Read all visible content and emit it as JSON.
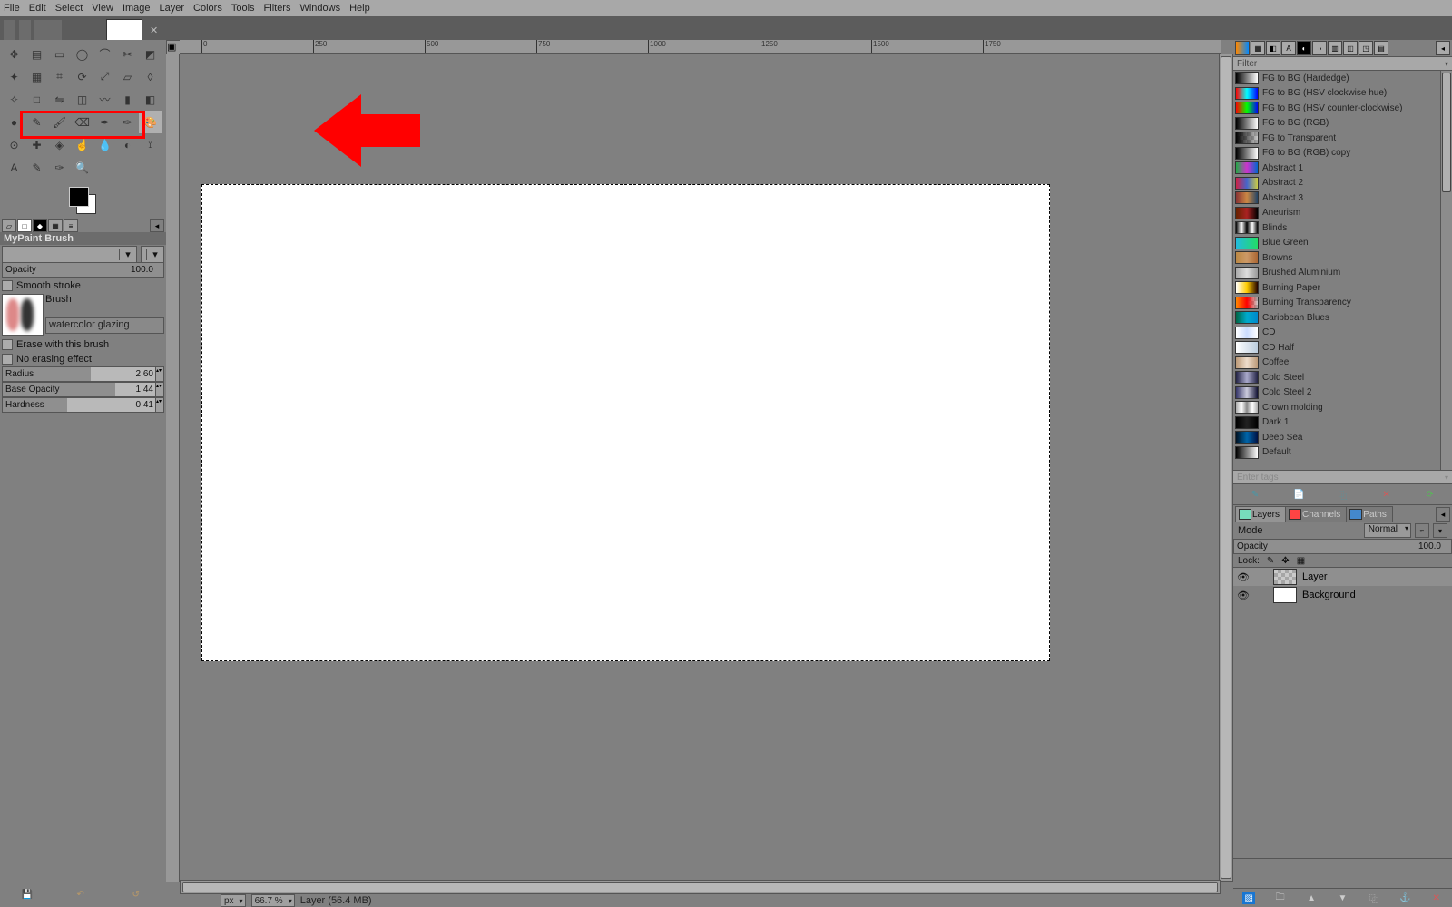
{
  "menu": [
    "File",
    "Edit",
    "Select",
    "View",
    "Image",
    "Layer",
    "Colors",
    "Tools",
    "Filters",
    "Windows",
    "Help"
  ],
  "tools": [
    {
      "n": "move-tool",
      "g": "✥"
    },
    {
      "n": "align-tool",
      "g": "▤"
    },
    {
      "n": "rect-select-tool",
      "g": "▭"
    },
    {
      "n": "ellipse-select-tool",
      "g": "◯"
    },
    {
      "n": "free-select-tool",
      "g": "⌒"
    },
    {
      "n": "scissors-tool",
      "g": "✂"
    },
    {
      "n": "foreground-select-tool",
      "g": "◩"
    },
    {
      "n": "fuzzy-select-tool",
      "g": "✦"
    },
    {
      "n": "by-color-select-tool",
      "g": "▦"
    },
    {
      "n": "crop-tool",
      "g": "⌗"
    },
    {
      "n": "rotate-tool",
      "g": "⟳"
    },
    {
      "n": "scale-tool",
      "g": "⤢"
    },
    {
      "n": "shear-tool",
      "g": "▱"
    },
    {
      "n": "perspective-tool",
      "g": "◊"
    },
    {
      "n": "unified-transform-tool",
      "g": "✧"
    },
    {
      "n": "handle-transform-tool",
      "g": "□"
    },
    {
      "n": "flip-tool",
      "g": "⇋"
    },
    {
      "n": "cage-tool",
      "g": "◫"
    },
    {
      "n": "warp-tool",
      "g": "〰"
    },
    {
      "n": "bucket-fill-tool",
      "g": "▮"
    },
    {
      "n": "gradient-tool",
      "g": "◧"
    },
    {
      "n": "n-point-tool",
      "g": "●"
    },
    {
      "n": "pencil-tool",
      "g": "✎",
      "hl": true
    },
    {
      "n": "paintbrush-tool",
      "g": "🖌",
      "hl": true
    },
    {
      "n": "eraser-tool",
      "g": "⌫",
      "hl": true
    },
    {
      "n": "airbrush-tool",
      "g": "✒",
      "hl": true
    },
    {
      "n": "ink-tool",
      "g": "✑",
      "hl": true
    },
    {
      "n": "mypaint-brush-tool",
      "g": "🎨",
      "on": true,
      "hl": true
    },
    {
      "n": "clone-tool",
      "g": "⊙"
    },
    {
      "n": "heal-tool",
      "g": "✚"
    },
    {
      "n": "perspective-clone-tool",
      "g": "◈"
    },
    {
      "n": "smudge-tool",
      "g": "☝"
    },
    {
      "n": "blur-tool",
      "g": "💧"
    },
    {
      "n": "dodge-burn-tool",
      "g": "◐"
    },
    {
      "n": "measure-tool",
      "g": "⟟"
    },
    {
      "n": "text-tool",
      "g": "A"
    },
    {
      "n": "paths-tool",
      "g": "✎"
    },
    {
      "n": "color-picker-tool",
      "g": "✑"
    },
    {
      "n": "zoom-tool",
      "g": "🔍"
    }
  ],
  "tool_options": {
    "title": "MyPaint Brush",
    "opacity": {
      "label": "Opacity",
      "value": "100.0",
      "pct": 100
    },
    "smooth": "Smooth stroke",
    "brush_label": "Brush",
    "brush_name": "watercolor glazing",
    "erase": "Erase with this brush",
    "noerase": "No erasing effect",
    "radius": {
      "label": "Radius",
      "value": "2.60",
      "pct": 55
    },
    "baseop": {
      "label": "Base Opacity",
      "value": "1.44",
      "pct": 70
    },
    "hard": {
      "label": "Hardness",
      "value": "0.41",
      "pct": 40
    }
  },
  "ruler_ticks": [
    "0",
    "250",
    "500",
    "750",
    "1000",
    "1250",
    "1500",
    "1750"
  ],
  "status": {
    "units": "px",
    "zoom": "66.7 %",
    "msg": "Layer (56.4 MB)"
  },
  "right_filter": "Filter",
  "gradients": [
    {
      "n": "FG to BG (Hardedge)",
      "c": [
        "#000",
        "#fff"
      ]
    },
    {
      "n": "FG to BG (HSV clockwise hue)",
      "c": [
        "#f00",
        "#0ff",
        "#00f"
      ]
    },
    {
      "n": "FG to BG (HSV counter-clockwise)",
      "c": [
        "#f00",
        "#0f0",
        "#00f"
      ]
    },
    {
      "n": "FG to BG (RGB)",
      "c": [
        "#000",
        "#fff"
      ]
    },
    {
      "n": "FG to Transparent",
      "c": [
        "#000",
        "#00000000"
      ],
      "trans": true
    },
    {
      "n": "FG to BG (RGB) copy",
      "c": [
        "#000",
        "#fff"
      ]
    },
    {
      "n": "Abstract 1",
      "c": [
        "#2a4",
        "#c3c",
        "#06c"
      ]
    },
    {
      "n": "Abstract 2",
      "c": [
        "#c24",
        "#46c",
        "#cc4"
      ]
    },
    {
      "n": "Abstract 3",
      "c": [
        "#833",
        "#c84",
        "#246"
      ]
    },
    {
      "n": "Aneurism",
      "c": [
        "#620",
        "#a22",
        "#000"
      ]
    },
    {
      "n": "Blinds",
      "c": [
        "#000",
        "#fff",
        "#000",
        "#fff",
        "#000"
      ]
    },
    {
      "n": "Blue Green",
      "c": [
        "#2bd",
        "#2d6"
      ]
    },
    {
      "n": "Browns",
      "c": [
        "#b84",
        "#c96",
        "#a63"
      ]
    },
    {
      "n": "Brushed Aluminium",
      "c": [
        "#aaa",
        "#ddd",
        "#999"
      ]
    },
    {
      "n": "Burning Paper",
      "c": [
        "#fff",
        "#fc0",
        "#200"
      ]
    },
    {
      "n": "Burning Transparency",
      "c": [
        "#f80",
        "#f00",
        "#00000000"
      ],
      "trans": true
    },
    {
      "n": "Caribbean Blues",
      "c": [
        "#064",
        "#0ac",
        "#08c"
      ]
    },
    {
      "n": "CD",
      "c": [
        "#fff",
        "#cdf",
        "#fff"
      ]
    },
    {
      "n": "CD Half",
      "c": [
        "#fff",
        "#bcd"
      ]
    },
    {
      "n": "Coffee",
      "c": [
        "#b97",
        "#edc",
        "#b97"
      ],
      "trans": true
    },
    {
      "n": "Cold Steel",
      "c": [
        "#224",
        "#aac",
        "#224"
      ]
    },
    {
      "n": "Cold Steel 2",
      "c": [
        "#336",
        "#ccd",
        "#113"
      ]
    },
    {
      "n": "Crown molding",
      "c": [
        "#aaa",
        "#fff",
        "#888",
        "#fff",
        "#aaa"
      ]
    },
    {
      "n": "Dark 1",
      "c": [
        "#000",
        "#222",
        "#000"
      ]
    },
    {
      "n": "Deep Sea",
      "c": [
        "#012",
        "#06a",
        "#014"
      ]
    },
    {
      "n": "Default",
      "c": [
        "#000",
        "#fff"
      ]
    }
  ],
  "tags_label": "Enter tags",
  "panel_tabs": [
    {
      "n": "Layers",
      "active": true,
      "ic": "#7db"
    },
    {
      "n": "Channels",
      "ic": "#f44"
    },
    {
      "n": "Paths",
      "ic": "#48c"
    }
  ],
  "mode": {
    "label": "Mode",
    "value": "Normal"
  },
  "layer_opacity": {
    "label": "Opacity",
    "value": "100.0",
    "pct": 100
  },
  "lock_label": "Lock:",
  "layers": [
    {
      "name": "Layer",
      "trans": true,
      "active": true
    },
    {
      "name": "Background",
      "trans": false
    }
  ]
}
